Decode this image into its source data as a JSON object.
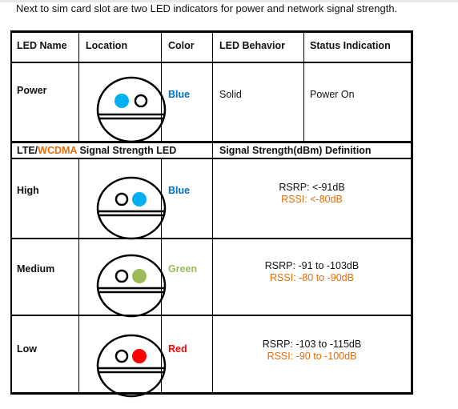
{
  "intro_text": "Next to sim card slot are two LED indicators for power and network signal strength.",
  "colors": {
    "blue_text": "#0070c0",
    "green_text": "#9bbb59",
    "red_text": "#ff0000",
    "orange_text": "#e36c09",
    "led_blue": "#00b0f0",
    "led_green": "#9bbb59",
    "led_red": "#ff0000"
  },
  "table": {
    "headers": [
      "LED Name",
      "Location",
      "Color",
      "LED Behavior",
      "Status Indication"
    ],
    "power_row": {
      "name": "Power",
      "color": "Blue",
      "behavior": "Solid",
      "status": "Power On",
      "lit_led": "left",
      "led_color": "blue"
    },
    "section_header": {
      "left_part1": "LTE/",
      "left_part2": "WCDMA",
      "left_part3": " Signal Strength LED",
      "right": "Signal Strength(dBm) Definition"
    },
    "signal_rows": [
      {
        "name": "High",
        "color": "Blue",
        "rsrp": "RSRP: <-91dB",
        "rssi": "RSSI: <-80dB",
        "lit_led": "right",
        "led_color": "blue"
      },
      {
        "name": "Medium",
        "color": "Green",
        "rsrp": "RSRP: -91 to -103dB",
        "rssi": "RSSI: -80 to -90dB",
        "lit_led": "right",
        "led_color": "green"
      },
      {
        "name": "Low",
        "color": "Red",
        "rsrp": "RSRP: -103 to -115dB",
        "rssi": "RSSI: -90 to -100dB",
        "lit_led": "right",
        "led_color": "red"
      }
    ]
  }
}
